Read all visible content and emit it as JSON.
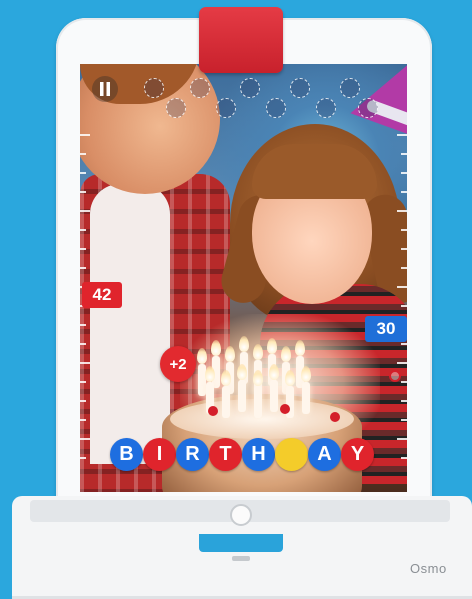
{
  "device": {
    "brand": "Osmo"
  },
  "game": {
    "pause_icon": "pause-icon",
    "left_score": "42",
    "right_score": "30",
    "bonus": "+2",
    "word": [
      {
        "char": "B",
        "color": "blue"
      },
      {
        "char": "I",
        "color": "red"
      },
      {
        "char": "R",
        "color": "blue"
      },
      {
        "char": "T",
        "color": "red"
      },
      {
        "char": "H",
        "color": "blue"
      },
      {
        "char": "",
        "color": "empty"
      },
      {
        "char": "A",
        "color": "blue"
      },
      {
        "char": "Y",
        "color": "red"
      }
    ],
    "balloon_slots": 10
  },
  "colors": {
    "background": "#2ba7dd",
    "reflector": "#d22a34",
    "letter_blue": "#1e6ee0",
    "letter_red": "#e0242c",
    "letter_empty": "#f4cc2a"
  }
}
